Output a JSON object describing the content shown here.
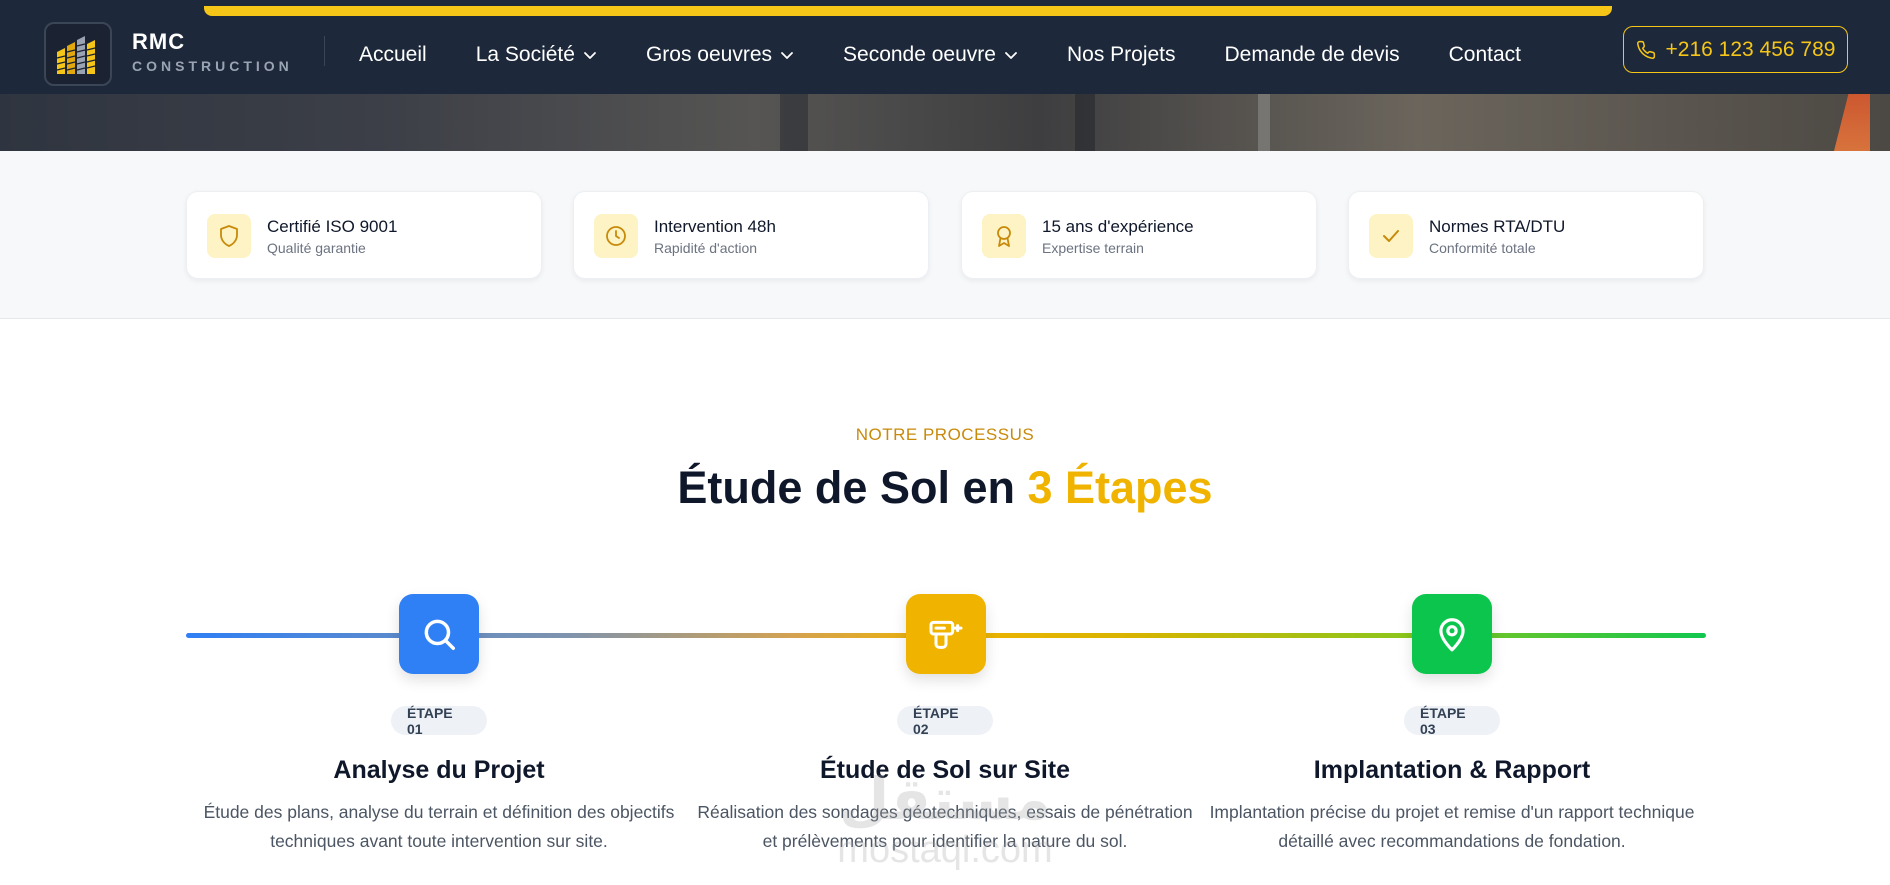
{
  "brand": {
    "name": "RMC",
    "tagline": "CONSTRUCTION"
  },
  "nav": {
    "items": [
      {
        "label": "Accueil",
        "dropdown": false
      },
      {
        "label": "La Société",
        "dropdown": true
      },
      {
        "label": "Gros oeuvres",
        "dropdown": true
      },
      {
        "label": "Seconde oeuvre",
        "dropdown": true
      },
      {
        "label": "Nos Projets",
        "dropdown": false
      },
      {
        "label": "Demande de devis",
        "dropdown": false
      },
      {
        "label": "Contact",
        "dropdown": false
      }
    ],
    "phone": "+216 123 456 789"
  },
  "features": [
    {
      "icon": "shield-icon",
      "title": "Certifié ISO 9001",
      "subtitle": "Qualité garantie"
    },
    {
      "icon": "clock-icon",
      "title": "Intervention 48h",
      "subtitle": "Rapidité d'action"
    },
    {
      "icon": "award-icon",
      "title": "15 ans d'expérience",
      "subtitle": "Expertise terrain"
    },
    {
      "icon": "check-icon",
      "title": "Normes RTA/DTU",
      "subtitle": "Conformité totale"
    }
  ],
  "process": {
    "eyebrow": "NOTRE PROCESSUS",
    "headline_main": "Étude de Sol en ",
    "headline_highlight": "3 Étapes",
    "steps": [
      {
        "badge": "ÉTAPE 01",
        "title": "Analyse du Projet",
        "description": "Étude des plans, analyse du terrain et définition des objectifs techniques avant toute intervention sur site.",
        "icon": "search-icon",
        "color": "#2f7ff5"
      },
      {
        "badge": "ÉTAPE 02",
        "title": "Étude de Sol sur Site",
        "description": "Réalisation des sondages géotechniques, essais de pénétration et prélèvements pour identifier la nature du sol.",
        "icon": "drill-icon",
        "color": "#f0b400"
      },
      {
        "badge": "ÉTAPE 03",
        "title": "Implantation & Rapport",
        "description": "Implantation précise du projet et remise d'un rapport technique détaillé avec recommandations de fondation.",
        "icon": "map-pin-icon",
        "color": "#0cc54d"
      }
    ]
  },
  "watermark": {
    "arabic": "مستقل",
    "latin": "mostaql.com"
  },
  "colors": {
    "navy": "#1d283a",
    "accent": "#f5c518",
    "highlight": "#f0b400"
  }
}
